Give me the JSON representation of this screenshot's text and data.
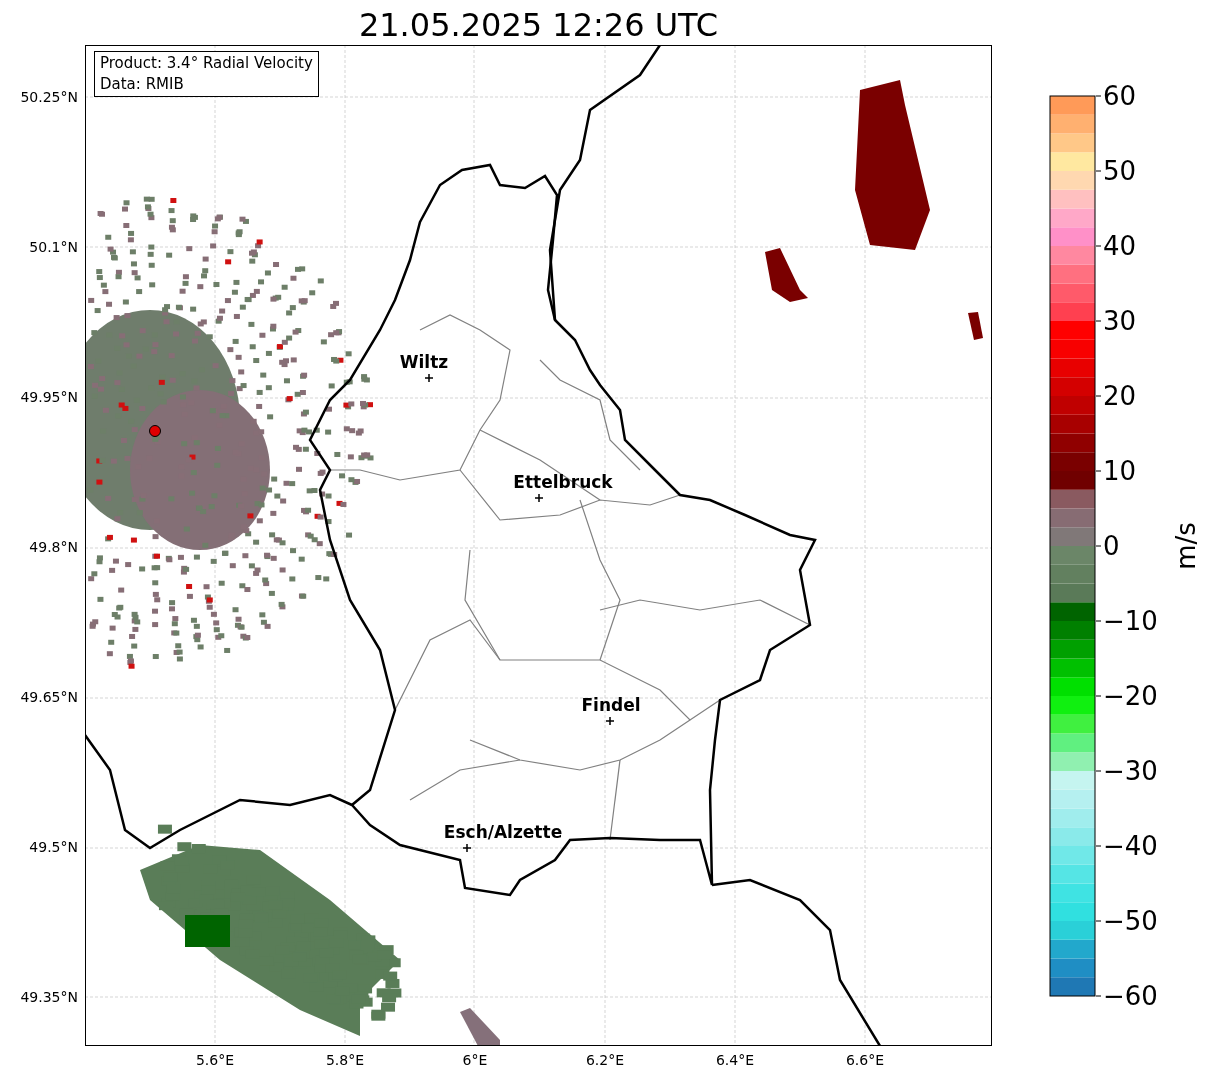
{
  "title": "21.05.2025 12:26 UTC",
  "legend": [
    "Product: 3.4° Radial Velocity",
    "Data: RMIB"
  ],
  "lat_ticks": [
    "50.25°N",
    "50.1°N",
    "49.95°N",
    "49.8°N",
    "49.65°N",
    "49.5°N",
    "49.35°N"
  ],
  "lon_ticks": [
    "5.6°E",
    "5.8°E",
    "6°E",
    "6.2°E",
    "6.4°E",
    "6.6°E"
  ],
  "cities": [
    {
      "name": "Wiltz"
    },
    {
      "name": "Ettelbruck"
    },
    {
      "name": "Findel"
    },
    {
      "name": "Esch/Alzette"
    }
  ],
  "colorbar": {
    "label": "m/s",
    "ticks": [
      "60",
      "50",
      "40",
      "30",
      "20",
      "10",
      "0",
      "−10",
      "−20",
      "−30",
      "−40",
      "−50",
      "−60"
    ]
  }
}
